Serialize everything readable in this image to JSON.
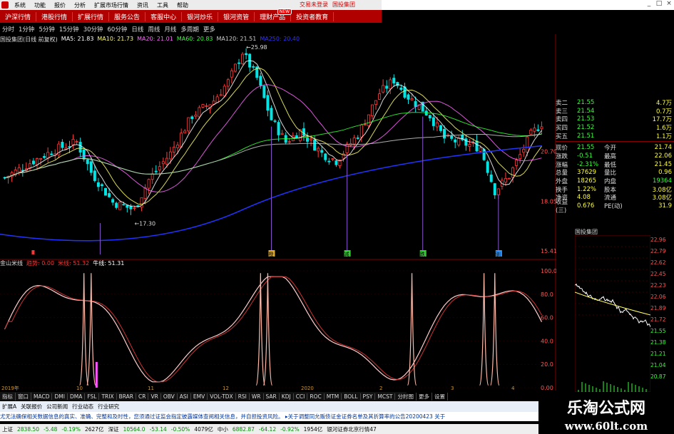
{
  "menu": {
    "items": [
      "系统",
      "功能",
      "报价",
      "分析",
      "扩展市场行情",
      "资讯",
      "工具",
      "帮助"
    ],
    "top_links": [
      "交易未登录",
      "国投集团"
    ]
  },
  "nav": {
    "tabs": [
      "沪深行情",
      "港股行情",
      "扩展行情",
      "服务公告",
      "客服中心",
      "银河炒乐",
      "银河资管",
      "理财产品",
      "投资者教育"
    ],
    "badge": "NEW"
  },
  "periods": [
    "分时",
    "1分钟",
    "5分钟",
    "15分钟",
    "30分钟",
    "60分钟",
    "日线",
    "周线",
    "月线",
    "多周期",
    "更多"
  ],
  "main_legend": {
    "stock": "国投集团(日线 前复权)",
    "ma": [
      {
        "label": "MA5: 21.83",
        "color": "#ffffff"
      },
      {
        "label": "MA10: 21.73",
        "color": "#ffff66"
      },
      {
        "label": "MA20: 21.01",
        "color": "#ff66ff"
      },
      {
        "label": "MA60: 20.83",
        "color": "#33ff33"
      },
      {
        "label": "MA120: 21.51",
        "color": "#cccccc"
      },
      {
        "label": "MA250: 20.40",
        "color": "#3333ff"
      }
    ]
  },
  "sub_legend": {
    "name": "金山米线",
    "items": [
      {
        "label": "趋势: 0.00",
        "color": "#ff3333"
      },
      {
        "label": "米线: 51.32",
        "color": "#ff3333"
      },
      {
        "label": "牛线: 51.31",
        "color": "#ffffff"
      }
    ]
  },
  "price_labels": {
    "high": "25.98",
    "low": "17.30",
    "p1": "20.70",
    "p2": "18.05",
    "p3": "15.41"
  },
  "signal_marks": [
    "橙",
    "减",
    "跌",
    "驯"
  ],
  "sub_axis": [
    "100.0",
    "80.0",
    "60.0",
    "40.0",
    "20.0",
    "0.00"
  ],
  "quote": {
    "sell": [
      {
        "l": "卖二",
        "v": "21.55",
        "r": "4.7万"
      },
      {
        "l": "卖三",
        "v": "21.54",
        "r": "0.7万"
      },
      {
        "l": "卖四",
        "v": "21.53",
        "r": "17.7万"
      },
      {
        "l": "买四",
        "v": "21.52",
        "r": "1.6万"
      },
      {
        "l": "买五",
        "v": "21.51",
        "r": "1.1万"
      }
    ],
    "stats": [
      {
        "l": "现价",
        "v": "21.55",
        "c": "今开",
        "r": "21.74"
      },
      {
        "l": "涨跌",
        "v": "-0.51",
        "c": "最高",
        "r": "22.06"
      },
      {
        "l": "涨幅",
        "v": "-2.31%",
        "c": "最低",
        "r": "21.45"
      },
      {
        "l": "总量",
        "v": "37629",
        "c": "量比",
        "r": "0.96"
      },
      {
        "l": "外盘",
        "v": "18265",
        "c": "内盘",
        "r": "19364"
      },
      {
        "l": "换手",
        "v": "1.22%",
        "c": "股本",
        "r": "3.08亿"
      },
      {
        "l": "净资",
        "v": "4.08",
        "c": "流通",
        "r": "3.08亿"
      },
      {
        "l": "收益(三)",
        "v": "0.676",
        "c": "PE(动)",
        "r": "31.9"
      }
    ]
  },
  "mini_chart": {
    "title": "国投集团",
    "ticks": [
      "22.96",
      "22.79",
      "22.62",
      "22.45",
      "22.23",
      "22.06",
      "21.89",
      "21.72",
      "21.55",
      "21.38",
      "21.21",
      "21.04",
      "20.87"
    ]
  },
  "indicator_tabs": [
    "指标",
    "窗口",
    "MACD",
    "DMI",
    "DMA",
    "FSL",
    "TRIX",
    "BRAR",
    "CR",
    "VR",
    "OBV",
    "ASI",
    "EMV",
    "VOL-TDX",
    "RSI",
    "WR",
    "SAR",
    "KDJ",
    "CCI",
    "ROC",
    "MTM",
    "BOLL",
    "PSY",
    "MCST",
    "分时图",
    "更多",
    "设置"
  ],
  "info_tabs": [
    "扩展A",
    "关联报价",
    "公司新闻",
    "行业动态",
    "行业研究"
  ],
  "news": "尤无法确保相关数据信息的真实、准确、完整和及时性，您须通过证监会指定披露媒体查阅相关信息，并自担投资风险。   ▸关于调整同允贩债证金证券名单及其折算率的公告20200423   关于",
  "status": [
    {
      "t": "上证",
      "cls": ""
    },
    {
      "t": "2838.50",
      "cls": "dn"
    },
    {
      "t": "-5.48",
      "cls": "dn"
    },
    {
      "t": "-0.19%",
      "cls": "dn"
    },
    {
      "t": "2627亿",
      "cls": ""
    },
    {
      "t": "深证",
      "cls": ""
    },
    {
      "t": "10564.0",
      "cls": "dn"
    },
    {
      "t": "-53.14",
      "cls": "dn"
    },
    {
      "t": "-0.50%",
      "cls": "dn"
    },
    {
      "t": "4079亿",
      "cls": ""
    },
    {
      "t": "中小",
      "cls": ""
    },
    {
      "t": "6882.87",
      "cls": "dn"
    },
    {
      "t": "-64.12",
      "cls": "dn"
    },
    {
      "t": "-0.92%",
      "cls": "dn"
    },
    {
      "t": "1954亿",
      "cls": ""
    },
    {
      "t": "银河证券北京行情47",
      "cls": ""
    }
  ],
  "watermark": {
    "line1": "乐淘公式网",
    "line2": "www.60lt.com"
  },
  "dates": [
    "2019年",
    "10",
    "11",
    "12",
    "2020",
    "2",
    "3",
    "4"
  ]
}
